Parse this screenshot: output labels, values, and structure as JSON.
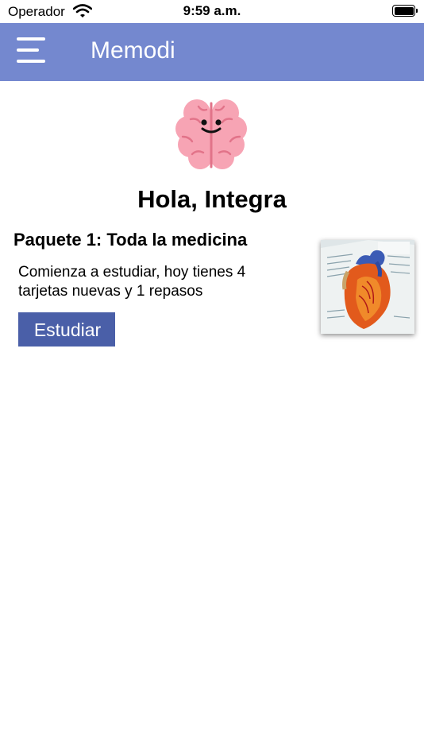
{
  "status_bar": {
    "carrier": "Operador",
    "time": "9:59 a.m."
  },
  "navbar": {
    "title": "Memodi"
  },
  "greeting": "Hola, Integra",
  "deck": {
    "title": "Paquete 1: Toda la medicina",
    "description": "Comienza a estudiar, hoy tienes 4 tarjetas nuevas y 1 repasos",
    "button_label": "Estudiar"
  },
  "icons": {
    "menu": "hamburger-menu-icon",
    "mascot": "brain-mascot-icon",
    "wifi": "wifi-icon",
    "battery": "battery-icon"
  },
  "colors": {
    "navbar": "#7488cf",
    "button": "#4a5fa8",
    "brain": "#f7a4b4"
  }
}
